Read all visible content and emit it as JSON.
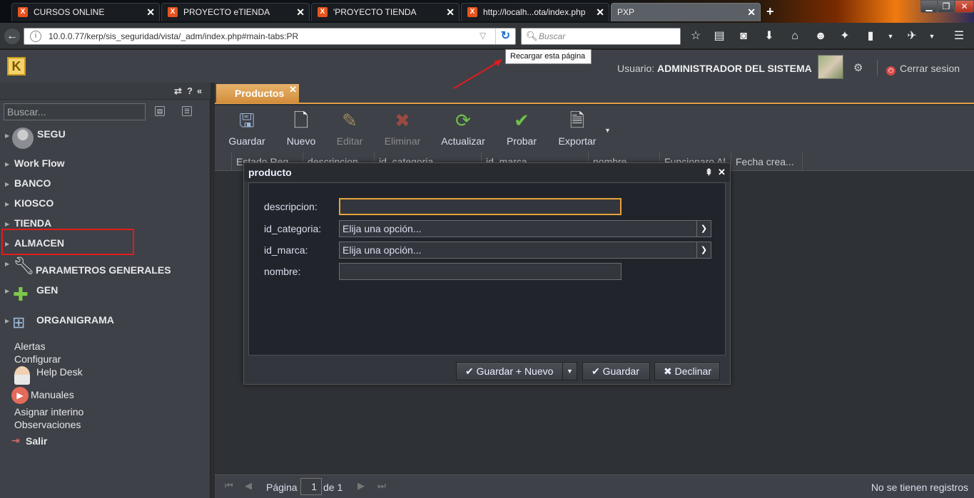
{
  "browser": {
    "tabs": [
      {
        "label": "CURSOS ONLINE",
        "icon": "xampp-icon"
      },
      {
        "label": "PROYECTO eTIENDA",
        "icon": "xampp-icon"
      },
      {
        "label": "'PROYECTO TIENDA",
        "icon": "xampp-icon"
      },
      {
        "label": "http://localh...ota/index.php",
        "icon": "xampp-icon"
      },
      {
        "label": "PXP",
        "icon": ""
      }
    ],
    "url": "10.0.0.77/kerp/sis_seguridad/vista/_adm/index.php#main-tabs:PR",
    "search_placeholder": "Buscar",
    "reload_tooltip": "Recargar esta página"
  },
  "app": {
    "user_label": "Usuario:",
    "user_name": "ADMINISTRADOR DEL SISTEMA",
    "logout": "Cerrar sesion"
  },
  "sidebar": {
    "search_placeholder": "Buscar...",
    "menu": [
      {
        "label": "SEGU",
        "icon": "users-icon"
      },
      {
        "label": "Work Flow"
      },
      {
        "label": "BANCO"
      },
      {
        "label": "KIOSCO"
      },
      {
        "label": "TIENDA"
      },
      {
        "label": "ALMACEN"
      },
      {
        "label": "PARAMETROS GENERALES",
        "icon": "wrench-icon"
      },
      {
        "label": "GEN",
        "icon": "puzzle-icon"
      },
      {
        "label": "ORGANIGRAMA",
        "icon": "org-chart-icon"
      }
    ],
    "links": [
      "Alertas",
      "Configurar",
      "Help Desk",
      "Manuales",
      "Asignar interino",
      "Observaciones",
      "Salir"
    ]
  },
  "main": {
    "tab_label": "Productos",
    "toolbar": [
      "Guardar",
      "Nuevo",
      "Editar",
      "Eliminar",
      "Actualizar",
      "Probar",
      "Exportar"
    ],
    "columns": [
      "Estado Reg.",
      "descripcion",
      "id_categoria",
      "id_marca",
      "nombre",
      "Funcionaro Al...",
      "Fecha crea..."
    ],
    "pager": {
      "page_label": "Página",
      "page": "1",
      "of_label": "de 1",
      "status": "No se tienen registros"
    }
  },
  "modal": {
    "title": "producto",
    "fields": {
      "descripcion": {
        "label": "descripcion:",
        "value": ""
      },
      "id_categoria": {
        "label": "id_categoria:",
        "value": "Elija una opción..."
      },
      "id_marca": {
        "label": "id_marca:",
        "value": "Elija una opción..."
      },
      "nombre": {
        "label": "nombre:",
        "value": ""
      }
    },
    "buttons": {
      "save_new": "Guardar + Nuevo",
      "save": "Guardar",
      "decline": "Declinar"
    }
  },
  "colors": {
    "accent": "#e39d48",
    "highlight_box": "#e01c1c",
    "panel": "#3e4147"
  }
}
